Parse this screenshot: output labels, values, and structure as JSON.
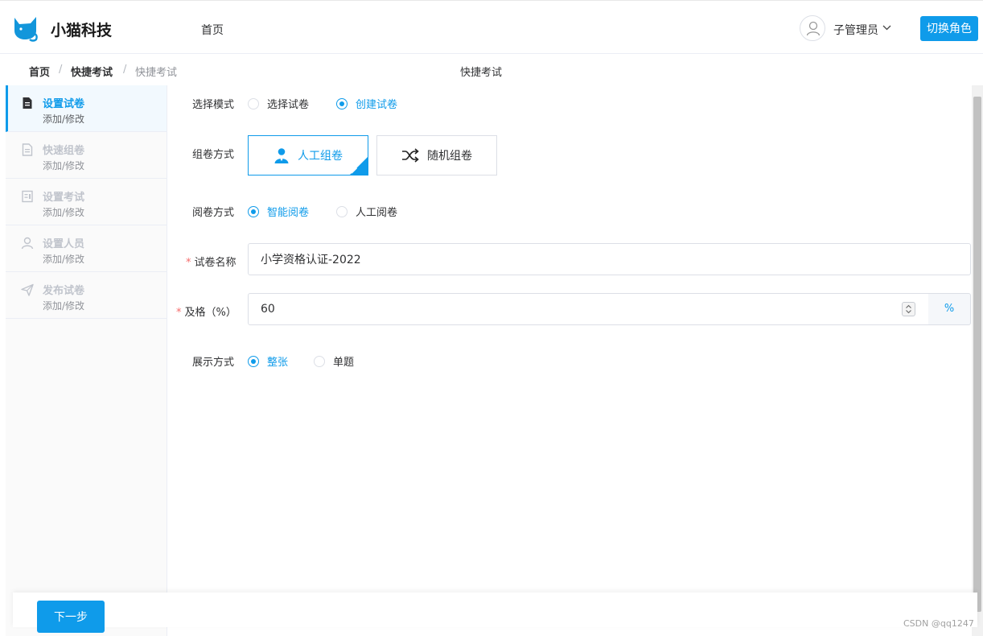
{
  "header": {
    "brand": "小猫科技",
    "nav_home": "首页",
    "user_name": "子管理员",
    "switch_role": "切换角色"
  },
  "breadcrumb": {
    "items": [
      "首页",
      "快捷考试",
      "快捷考试"
    ],
    "separator": "/"
  },
  "page_title": "快捷考试",
  "sidebar": {
    "steps": [
      {
        "title": "设置试卷",
        "sub": "添加/修改",
        "icon": "document-icon"
      },
      {
        "title": "快速组卷",
        "sub": "添加/修改",
        "icon": "file-list-icon"
      },
      {
        "title": "设置考试",
        "sub": "添加/修改",
        "icon": "exam-form-icon"
      },
      {
        "title": "设置人员",
        "sub": "添加/修改",
        "icon": "user-icon"
      },
      {
        "title": "发布试卷",
        "sub": "添加/修改",
        "icon": "send-icon"
      }
    ]
  },
  "form": {
    "mode": {
      "label": "选择模式",
      "options": [
        "选择试卷",
        "创建试卷"
      ],
      "selected": "创建试卷"
    },
    "compose": {
      "label": "组卷方式",
      "options": [
        "人工组卷",
        "随机组卷"
      ],
      "selected": "人工组卷"
    },
    "grading": {
      "label": "阅卷方式",
      "options": [
        "智能阅卷",
        "人工阅卷"
      ],
      "selected": "智能阅卷"
    },
    "paper_name": {
      "label": "试卷名称",
      "value": "小学资格认证-2022"
    },
    "pass_rate": {
      "label": "及格（%）",
      "value": "60",
      "suffix": "%"
    },
    "display": {
      "label": "展示方式",
      "options": [
        "整张",
        "单题"
      ],
      "selected": "整张"
    }
  },
  "footer": {
    "next_label": "下一步"
  },
  "watermark": "CSDN @qq1247",
  "colors": {
    "accent": "#0f9bea",
    "required": "#f56c6c"
  }
}
